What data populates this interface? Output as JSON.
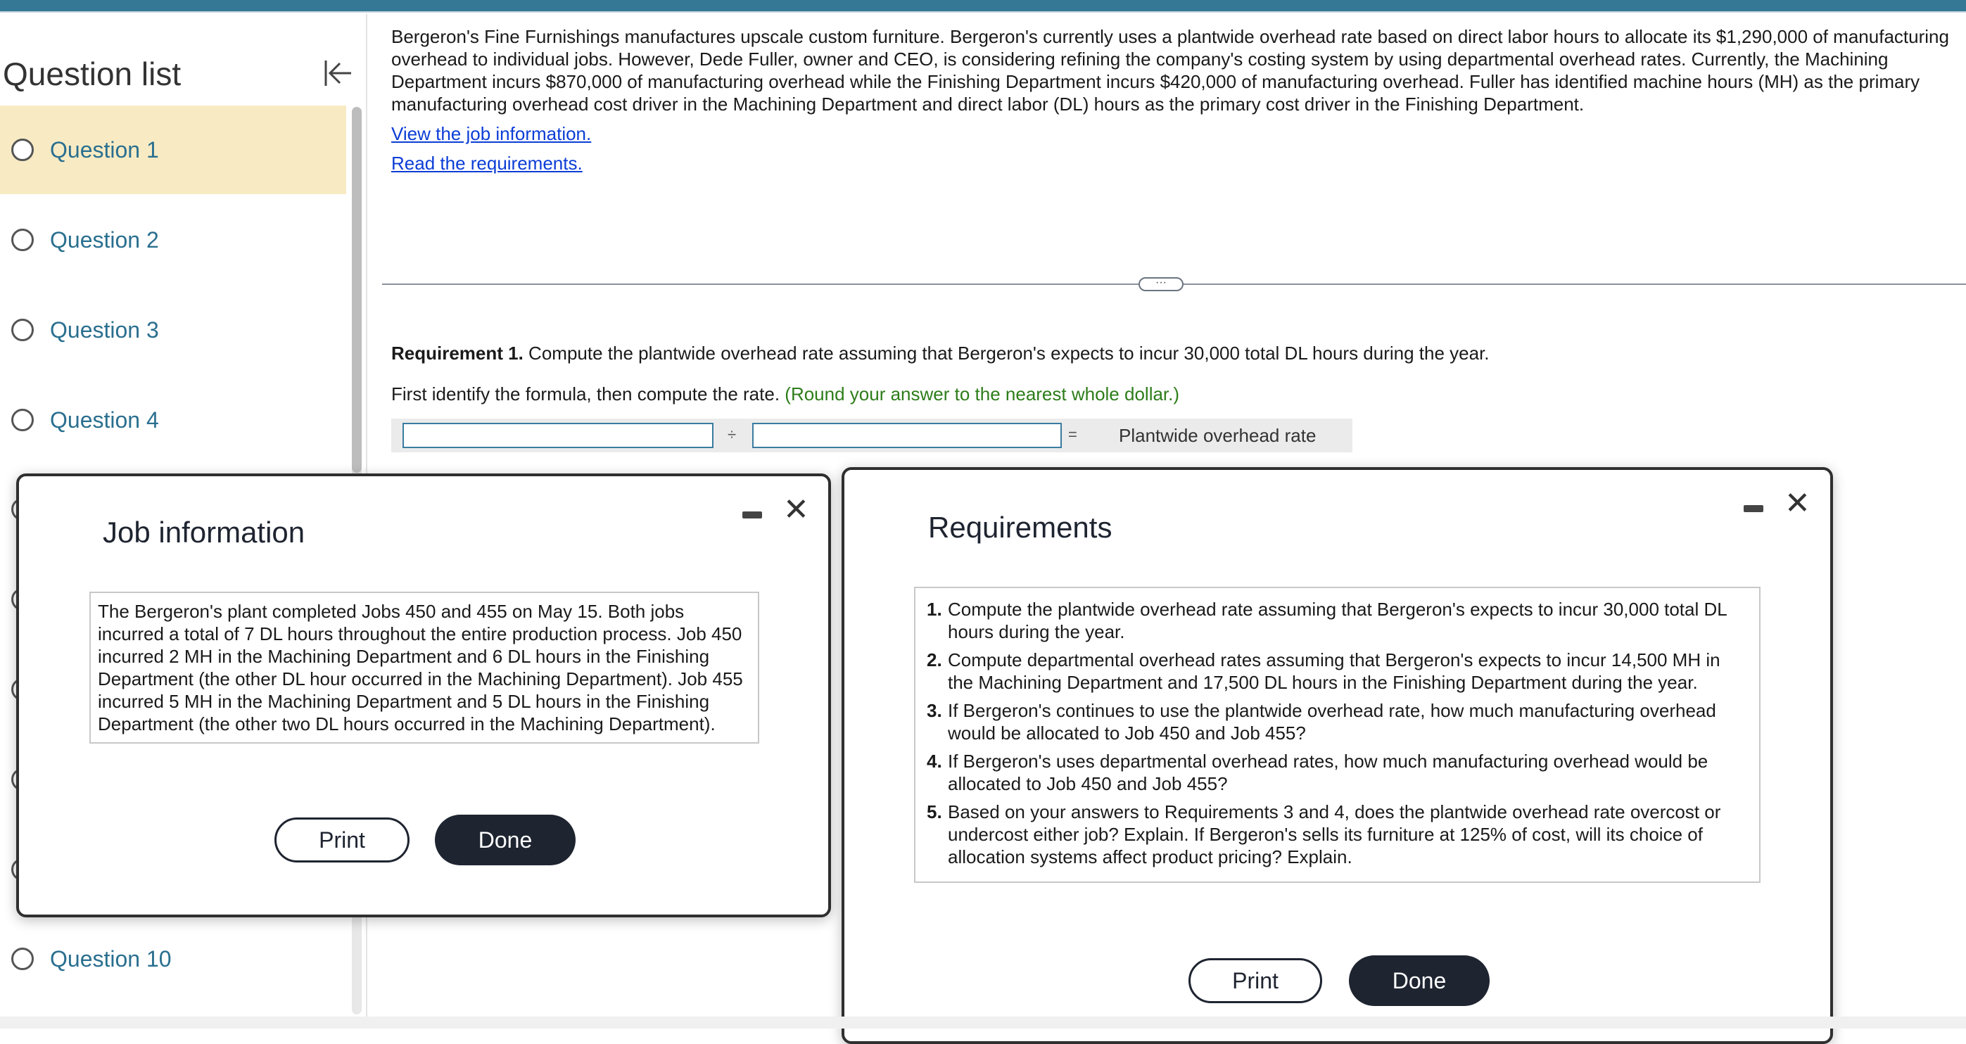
{
  "sidebar": {
    "title": "Question list",
    "collapse_icon": "collapse-left-icon",
    "items": [
      {
        "label": "Question 1",
        "active": true
      },
      {
        "label": "Question 2"
      },
      {
        "label": "Question 3"
      },
      {
        "label": "Question 4"
      },
      {
        "label": "Question 10"
      }
    ]
  },
  "main": {
    "intro": "Bergeron's Fine Furnishings manufactures upscale custom furniture. Bergeron's currently uses a plantwide overhead rate based on direct labor hours to allocate its $1,290,000 of manufacturing overhead to individual jobs. However, Dede Fuller, owner and CEO, is considering refining the company's costing system by using departmental overhead rates. Currently, the Machining Department incurs $870,000 of manufacturing overhead while the Finishing Department incurs $420,000 of manufacturing overhead. Fuller has identified machine hours (MH) as the primary manufacturing overhead cost driver in the Machining Department and direct labor (DL) hours as the primary cost driver in the Finishing Department.",
    "link_job": "View the job information.",
    "link_req": "Read the requirements.",
    "separator_label": "···",
    "req1_bold": "Requirement 1.",
    "req1_text": " Compute the plantwide overhead rate assuming that Bergeron's expects to incur 30,000 total DL hours during the year.",
    "instruction": "First identify the formula, then compute the rate. ",
    "instruction_hint": "(Round your answer to the nearest whole dollar.)",
    "formula": {
      "input1_value": "",
      "divide": "÷",
      "input2_value": "",
      "equals": "=",
      "result_label": "Plantwide overhead rate"
    },
    "hint_color": "#2d7d1a",
    "link_color": "#0b3dd6"
  },
  "job_modal": {
    "title": "Job information",
    "text": "The Bergeron's plant completed Jobs 450 and 455 on May 15. Both jobs incurred a total of 7 DL hours throughout the entire production process. Job 450 incurred 2 MH in the Machining Department and 6 DL hours in the Finishing Department (the other DL hour occurred in the Machining Department). Job 455 incurred 5 MH in the Machining Department and 5 DL hours in the Finishing Department (the other two DL hours occurred in the Machining Department).",
    "print": "Print",
    "done": "Done"
  },
  "req_modal": {
    "title": "Requirements",
    "items": [
      {
        "num": "1.",
        "text": "Compute the plantwide overhead rate assuming that Bergeron's expects to incur 30,000 total DL hours during the year."
      },
      {
        "num": "2.",
        "text": "Compute departmental overhead rates assuming that Bergeron's expects to incur 14,500 MH in the Machining Department and 17,500 DL hours in the Finishing Department during the year."
      },
      {
        "num": "3.",
        "text": "If Bergeron's continues to use the plantwide overhead rate, how much manufacturing overhead would be allocated to Job 450 and Job 455?"
      },
      {
        "num": "4.",
        "text": "If Bergeron's uses departmental overhead rates, how much manufacturing overhead would be allocated to Job 450 and Job 455?"
      },
      {
        "num": "5.",
        "text": "Based on your answers to Requirements 3 and 4, does the plantwide overhead rate overcost or undercost either job? Explain. If Bergeron's sells its furniture at 125% of cost, will its choice of allocation systems affect product pricing? Explain."
      }
    ],
    "print": "Print",
    "done": "Done"
  }
}
